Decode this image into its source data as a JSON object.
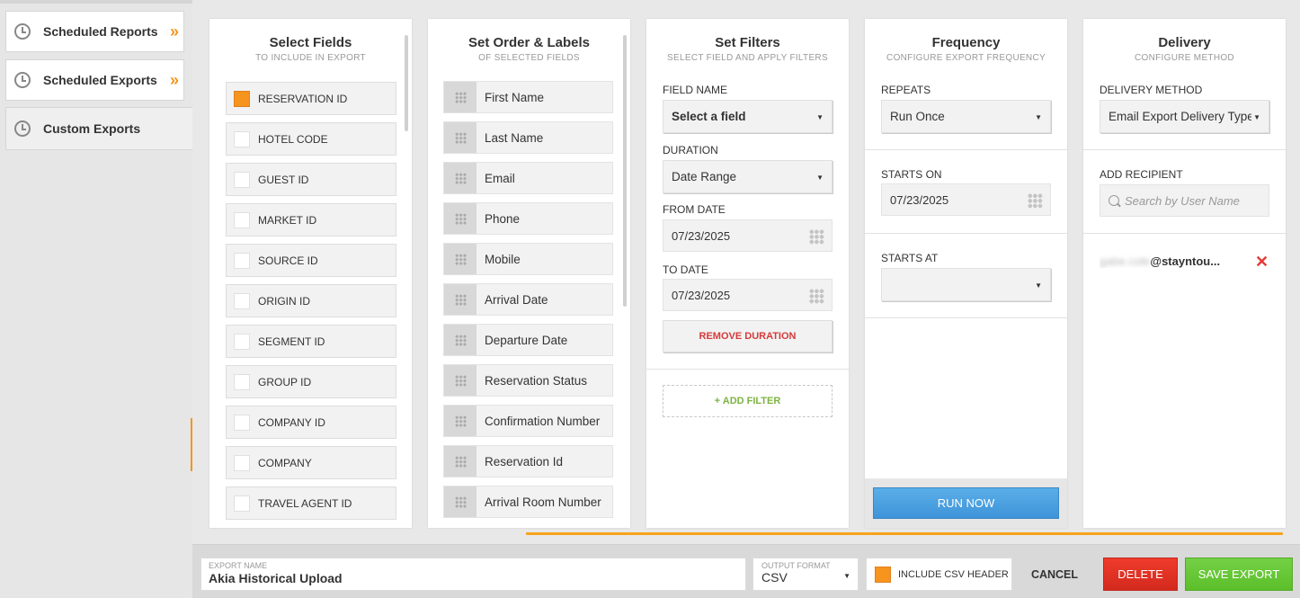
{
  "sidebar": {
    "items": [
      {
        "label": "Scheduled Reports",
        "chevron": "»"
      },
      {
        "label": "Scheduled Exports",
        "chevron": "»"
      },
      {
        "label": "Custom Exports"
      }
    ]
  },
  "select_fields": {
    "title": "Select Fields",
    "subtitle": "TO INCLUDE IN EXPORT",
    "items": [
      {
        "label": "RESERVATION ID",
        "checked": true
      },
      {
        "label": "HOTEL CODE",
        "checked": false
      },
      {
        "label": "GUEST ID",
        "checked": false
      },
      {
        "label": "MARKET ID",
        "checked": false
      },
      {
        "label": "SOURCE ID",
        "checked": false
      },
      {
        "label": "ORIGIN ID",
        "checked": false
      },
      {
        "label": "SEGMENT ID",
        "checked": false
      },
      {
        "label": "GROUP ID",
        "checked": false
      },
      {
        "label": "COMPANY ID",
        "checked": false
      },
      {
        "label": "COMPANY",
        "checked": false
      },
      {
        "label": "TRAVEL AGENT ID",
        "checked": false
      }
    ]
  },
  "order_labels": {
    "title": "Set Order & Labels",
    "subtitle": "OF SELECTED FIELDS",
    "items": [
      "First Name",
      "Last Name",
      "Email",
      "Phone",
      "Mobile",
      "Arrival Date",
      "Departure Date",
      "Reservation Status",
      "Confirmation Number",
      "Reservation Id",
      "Arrival Room Number"
    ]
  },
  "filters": {
    "title": "Set Filters",
    "subtitle": "SELECT FIELD AND APPLY FILTERS",
    "field_name_label": "FIELD NAME",
    "field_name_value": "Select a field",
    "duration_label": "DURATION",
    "duration_value": "Date Range",
    "from_date_label": "FROM DATE",
    "from_date_value": "07/23/2025",
    "to_date_label": "TO DATE",
    "to_date_value": "07/23/2025",
    "remove_duration": "REMOVE DURATION",
    "add_filter": "+ ADD FILTER"
  },
  "frequency": {
    "title": "Frequency",
    "subtitle": "CONFIGURE EXPORT FREQUENCY",
    "repeats_label": "REPEATS",
    "repeats_value": "Run Once",
    "starts_on_label": "STARTS ON",
    "starts_on_value": "07/23/2025",
    "starts_at_label": "STARTS AT",
    "starts_at_value": "",
    "run_now": "RUN NOW"
  },
  "delivery": {
    "title": "Delivery",
    "subtitle": "CONFIGURE METHOD",
    "method_label": "DELIVERY METHOD",
    "method_value": "Email Export Delivery Type",
    "add_recipient_label": "ADD RECIPIENT",
    "search_placeholder": "Search by User Name",
    "recipient_blurred": "gabe.cole",
    "recipient_domain": "@stayntou..."
  },
  "footer": {
    "export_name_label": "EXPORT NAME",
    "export_name_value": "Akia Historical Upload",
    "output_format_label": "OUTPUT FORMAT",
    "output_format_value": "CSV",
    "include_csv_header": "INCLUDE CSV HEADER",
    "include_csv_header_checked": true,
    "cancel": "CANCEL",
    "delete": "DELETE",
    "save": "SAVE EXPORT"
  },
  "colors": {
    "accent": "#f7941d",
    "run_now": "#4aa3e3",
    "delete": "#e3342a",
    "save": "#6cc93a",
    "remove": "#d63a3a",
    "add": "#7cb342"
  }
}
